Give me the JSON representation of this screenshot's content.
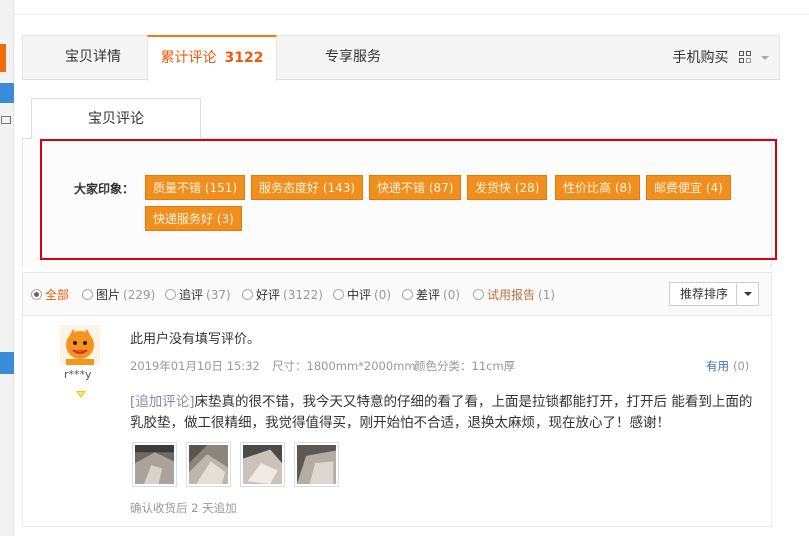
{
  "tabs": {
    "details": "宝贝详情",
    "reviews_label": "累计评论",
    "reviews_count": "3122",
    "services": "专享服务",
    "mobile_buy": "手机购买"
  },
  "sub_tab": "宝贝评论",
  "impressions": {
    "label": "大家印象：",
    "tags": [
      "质量不错 (151)",
      "服务态度好 (143)",
      "快递不错 (87)",
      "发货快 (28)",
      "性价比高 (8)",
      "邮费便宜 (4)",
      "快递服务好 (3)"
    ]
  },
  "filters": {
    "all": "全部",
    "pictures": {
      "label": "图片",
      "count": "(229)"
    },
    "followup": {
      "label": "追评",
      "count": "(37)"
    },
    "good": {
      "label": "好评",
      "count": "(3122)"
    },
    "neutral": {
      "label": "中评",
      "count": "(0)"
    },
    "bad": {
      "label": "差评",
      "count": "(0)"
    },
    "trial": {
      "label": "试用报告",
      "count": "(1)"
    },
    "sort": "推荐排序"
  },
  "review": {
    "username": "r***y",
    "text": "此用户没有填写评价。",
    "date": "2019年01月10日 15:32",
    "size": "尺寸：1800mm*2000mm",
    "color": "颜色分类：11cm厚",
    "useful_label": "有用",
    "useful_count": "(0)",
    "append_tag": "[追加评论]",
    "append_text": "床垫真的很不错，我今天又特意的仔细的看了看，上面是拉锁都能打开，打开后 能看到上面的乳胶垫，做工很精细，我觉得值得买，刚开始怕不合适，退换太麻烦，现在放心了！感谢！",
    "confirm": "确认收货后 2 天追加"
  },
  "colors": {
    "accent": "#f05a0a",
    "tag_bg": "#f08f1e",
    "highlight_box": "#d8000c"
  }
}
